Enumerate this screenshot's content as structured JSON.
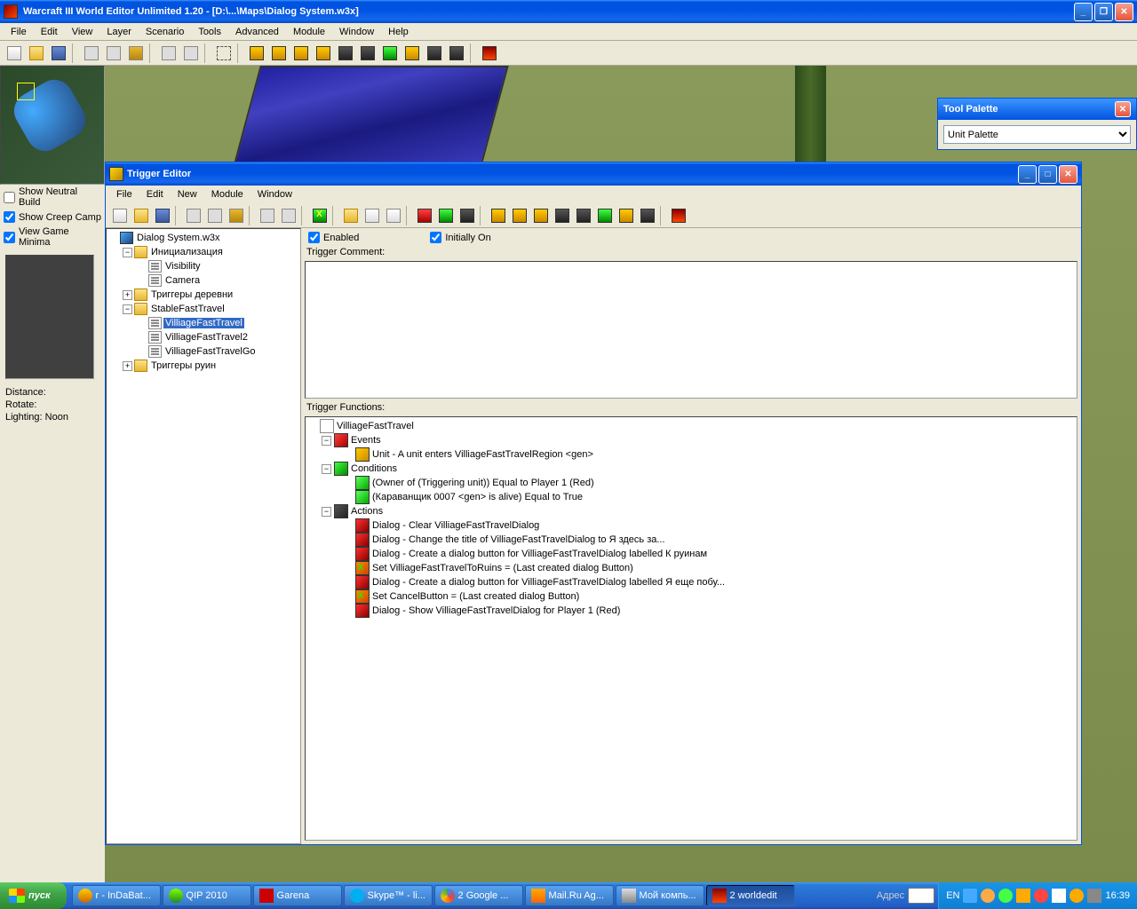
{
  "main": {
    "title": "Warcraft III World Editor Unlimited 1.20 - [D:\\...\\Maps\\Dialog System.w3x]",
    "menu": [
      "File",
      "Edit",
      "View",
      "Layer",
      "Scenario",
      "Tools",
      "Advanced",
      "Module",
      "Window",
      "Help"
    ]
  },
  "left": {
    "checks": {
      "neutral": "Show Neutral Build",
      "creep": "Show Creep Camp",
      "minimap": "View Game Minima"
    },
    "stats": {
      "distance": "Distance:",
      "rotate": "Rotate:",
      "lighting": "Lighting: Noon"
    }
  },
  "palette": {
    "title": "Tool Palette",
    "selected": "Unit Palette"
  },
  "trigger": {
    "title": "Trigger Editor",
    "menu": [
      "File",
      "Edit",
      "New",
      "Module",
      "Window"
    ],
    "root": "Dialog System.w3x",
    "folders": {
      "init": "Инициализация",
      "visibility": "Visibility",
      "camera": "Camera",
      "village_triggers": "Триггеры деревни",
      "stable": "StableFastTravel",
      "vft": "VilliageFastTravel",
      "vft2": "VilliageFastTravel2",
      "vftgo": "VilliageFastTravelGo",
      "ruins": "Триггеры руин"
    },
    "enabled": "Enabled",
    "initially_on": "Initially On",
    "comment_label": "Trigger Comment:",
    "funcs_label": "Trigger Functions:",
    "funcs": {
      "root": "VilliageFastTravel",
      "events": "Events",
      "event1": "Unit - A unit enters VilliageFastTravelRegion <gen>",
      "conditions": "Conditions",
      "cond1": "(Owner of (Triggering unit)) Equal to Player 1 (Red)",
      "cond2": "(Караванщик 0007 <gen> is alive) Equal to True",
      "actions": "Actions",
      "act1": "Dialog - Clear VilliageFastTravelDialog",
      "act2": "Dialog - Change the title of VilliageFastTravelDialog to Я здесь за...",
      "act3": "Dialog - Create a dialog button for VilliageFastTravelDialog labelled К руинам",
      "act4": "Set VilliageFastTravelToRuins = (Last created dialog Button)",
      "act5": "Dialog - Create a dialog button for VilliageFastTravelDialog labelled Я еще побу...",
      "act6": "Set CancelButton = (Last created dialog Button)",
      "act7": "Dialog - Show VilliageFastTravelDialog for Player 1 (Red)"
    }
  },
  "taskbar": {
    "start": "пуск",
    "items": [
      "r - InDaBat...",
      "QIP 2010",
      "Garena",
      "Skype™ - li...",
      "2 Google ...",
      "Mail.Ru Ag...",
      "Мой компь...",
      "2 worldedit"
    ],
    "addr_label": "Адрес",
    "lang": "EN",
    "clock": "16:39"
  }
}
